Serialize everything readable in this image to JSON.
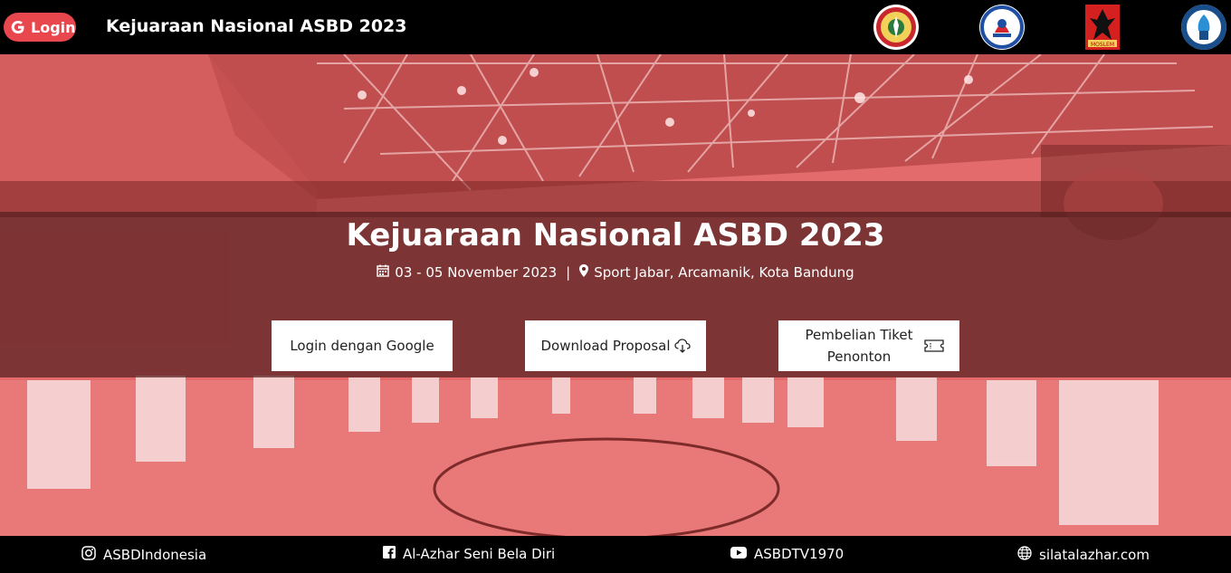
{
  "nav": {
    "login_label": "Login",
    "title": "Kejuaraan Nasional ASBD 2023",
    "logos": [
      "ipsi-logo",
      "kemenpora-logo",
      "moslem-martial-arts-logo",
      "yayasan-pesantren-al-azhar-logo"
    ]
  },
  "hero": {
    "title": "Kejuaraan Nasional ASBD 2023",
    "date": "03 - 05 November 2023",
    "separator": "|",
    "location": "Sport Jabar, Arcamanik, Kota Bandung",
    "buttons": {
      "google_login": "Login dengan Google",
      "download_proposal": "Download Proposal",
      "ticket_line1": "Pembelian Tiket",
      "ticket_line2": "Penonton"
    }
  },
  "footer": {
    "instagram": "ASBDIndonesia",
    "facebook": "Al-Azhar Seni Bela Diri",
    "youtube": "ASBDTV1970",
    "website": "silatalazhar.com"
  },
  "colors": {
    "accent": "#e8474e",
    "hero_tint": "#e26a6a",
    "band": "#551e1e"
  }
}
